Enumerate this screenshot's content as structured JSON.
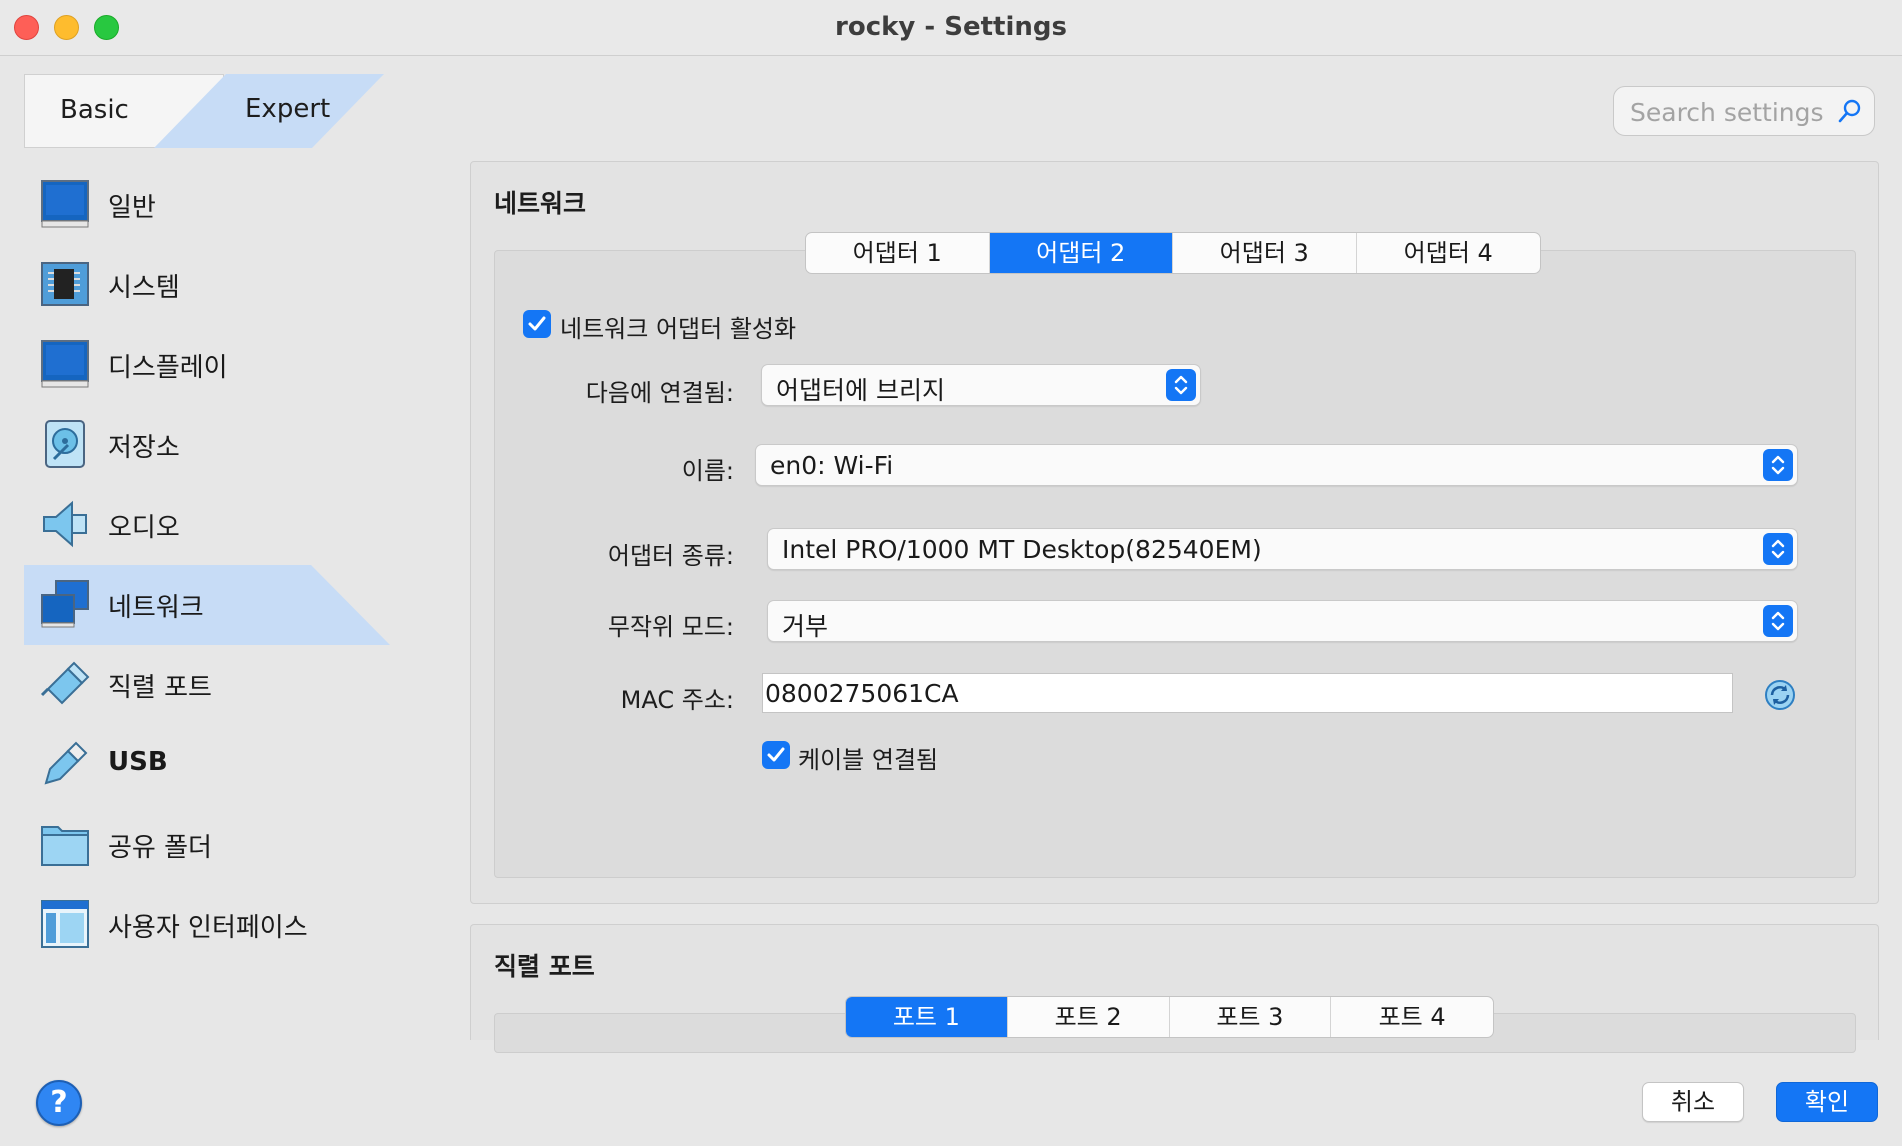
{
  "window": {
    "title": "rocky - Settings"
  },
  "mode_tabs": {
    "basic": "Basic",
    "expert": "Expert",
    "selected": "Expert"
  },
  "search": {
    "placeholder": "Search settings"
  },
  "sidebar": {
    "items": [
      {
        "label": "일반",
        "icon": "general-monitor-icon"
      },
      {
        "label": "시스템",
        "icon": "system-chip-icon"
      },
      {
        "label": "디스플레이",
        "icon": "display-monitor-icon"
      },
      {
        "label": "저장소",
        "icon": "storage-disk-icon"
      },
      {
        "label": "오디오",
        "icon": "audio-speaker-icon"
      },
      {
        "label": "네트워크",
        "icon": "network-icon"
      },
      {
        "label": "직렬 포트",
        "icon": "serial-port-icon"
      },
      {
        "label": "USB",
        "icon": "usb-icon"
      },
      {
        "label": "공유 폴더",
        "icon": "shared-folder-icon"
      },
      {
        "label": "사용자 인터페이스",
        "icon": "user-interface-icon"
      }
    ],
    "selected": "네트워크"
  },
  "network": {
    "title": "네트워크",
    "tabs": [
      "어댑터 1",
      "어댑터 2",
      "어댑터 3",
      "어댑터 4"
    ],
    "active_tab": "어댑터 2",
    "enable_adapter": {
      "label": "네트워크 어댑터 활성화",
      "checked": true
    },
    "attached_to": {
      "label": "다음에 연결됨:",
      "value": "어댑터에 브리지"
    },
    "name": {
      "label": "이름:",
      "value": "en0: Wi-Fi"
    },
    "adapter_type": {
      "label": "어댑터 종류:",
      "value": "Intel PRO/1000 MT Desktop(82540EM)"
    },
    "promiscuous": {
      "label": "무작위 모드:",
      "value": "거부"
    },
    "mac": {
      "label": "MAC 주소:",
      "value": "0800275061CA"
    },
    "cable_connected": {
      "label": "케이블 연결됨",
      "checked": true
    }
  },
  "serial": {
    "title": "직렬 포트",
    "tabs": [
      "포트 1",
      "포트 2",
      "포트 3",
      "포트 4"
    ],
    "active_tab": "포트 1"
  },
  "footer": {
    "help": "?",
    "cancel": "취소",
    "ok": "확인"
  },
  "colors": {
    "accent": "#1476f5",
    "selection": "#c7dcf6"
  }
}
